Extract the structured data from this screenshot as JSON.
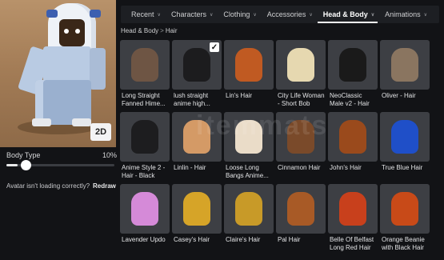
{
  "avatar": {
    "toggle_label": "2D",
    "body_type_label": "Body Type",
    "body_type_value": "10%",
    "body_type_fraction": 0.1,
    "loading_question": "Avatar isn't loading correctly?",
    "redraw_label": "Redraw"
  },
  "tabs": [
    {
      "label": "Recent",
      "active": false
    },
    {
      "label": "Characters",
      "active": false
    },
    {
      "label": "Clothing",
      "active": false
    },
    {
      "label": "Accessories",
      "active": false
    },
    {
      "label": "Head & Body",
      "active": true
    },
    {
      "label": "Animations",
      "active": false
    }
  ],
  "breadcrumb": {
    "parent": "Head & Body",
    "separator": ">",
    "current": "Hair"
  },
  "watermark": "itemmats",
  "items": [
    {
      "name": "Long Straight Fanned Hime...",
      "color": "#6e5544",
      "selected": false
    },
    {
      "name": "lush straight anime high...",
      "color": "#1c1c1e",
      "selected": true
    },
    {
      "name": "Lin's Hair",
      "color": "#c05a22",
      "selected": false
    },
    {
      "name": "City Life Woman - Short Bob",
      "color": "#e6d8b0",
      "selected": false
    },
    {
      "name": "NeoClassic Male v2 - Hair",
      "color": "#1a1a1a",
      "selected": false
    },
    {
      "name": "Oliver - Hair",
      "color": "#8a7560",
      "selected": false
    },
    {
      "name": "Anime Style 2 - Hair - Black",
      "color": "#1d1d1f",
      "selected": false
    },
    {
      "name": "Linlin - Hair",
      "color": "#d49a66",
      "selected": false
    },
    {
      "name": "Loose Long Bangs Anime...",
      "color": "#eadcc8",
      "selected": false
    },
    {
      "name": "Cinnamon Hair",
      "color": "#7a4a2a",
      "selected": false
    },
    {
      "name": "John's Hair",
      "color": "#9a4a1c",
      "selected": false
    },
    {
      "name": "True Blue Hair",
      "color": "#1f4fc8",
      "selected": false
    },
    {
      "name": "Lavender Updo",
      "color": "#d58ad8",
      "selected": false
    },
    {
      "name": "Casey's Hair",
      "color": "#d6a428",
      "selected": false
    },
    {
      "name": "Claire's Hair",
      "color": "#c89a28",
      "selected": false
    },
    {
      "name": "Pal Hair",
      "color": "#a85a26",
      "selected": false
    },
    {
      "name": "Belle Of Belfast Long Red Hair",
      "color": "#c8401c",
      "selected": false
    },
    {
      "name": "Orange Beanie with Black Hair",
      "color": "#c84a18",
      "selected": false
    }
  ]
}
